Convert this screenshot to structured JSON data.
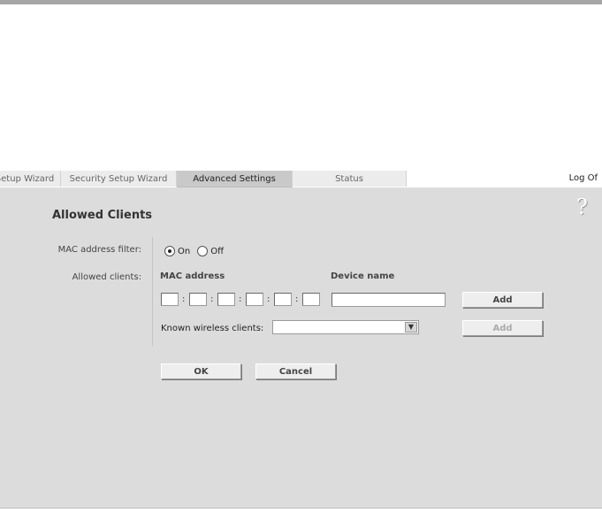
{
  "tabs": [
    {
      "label": "Setup Wizard",
      "active": false
    },
    {
      "label": "Security Setup Wizard",
      "active": false
    },
    {
      "label": "Advanced Settings",
      "active": true
    },
    {
      "label": "Status",
      "active": false
    }
  ],
  "header": {
    "logoff_label": "Log Of"
  },
  "page": {
    "title": "Allowed Clients",
    "help_glyph": "?"
  },
  "mac_filter": {
    "label": "MAC address filter:",
    "options": [
      {
        "label": "On",
        "checked": true
      },
      {
        "label": "Off",
        "checked": false
      }
    ]
  },
  "allowed_clients": {
    "label": "Allowed clients:",
    "mac_header": "MAC address",
    "device_header": "Device name",
    "mac_separator": ":",
    "mac_octets": [
      "",
      "",
      "",
      "",
      "",
      ""
    ],
    "device_name_value": "",
    "add_label": "Add",
    "known_label": "Known wireless clients:",
    "known_selected": "",
    "add_known_label": "Add"
  },
  "actions": {
    "ok_label": "OK",
    "cancel_label": "Cancel"
  },
  "icons": {
    "help": "help-question-icon",
    "dropdown": "chevron-down-icon"
  }
}
